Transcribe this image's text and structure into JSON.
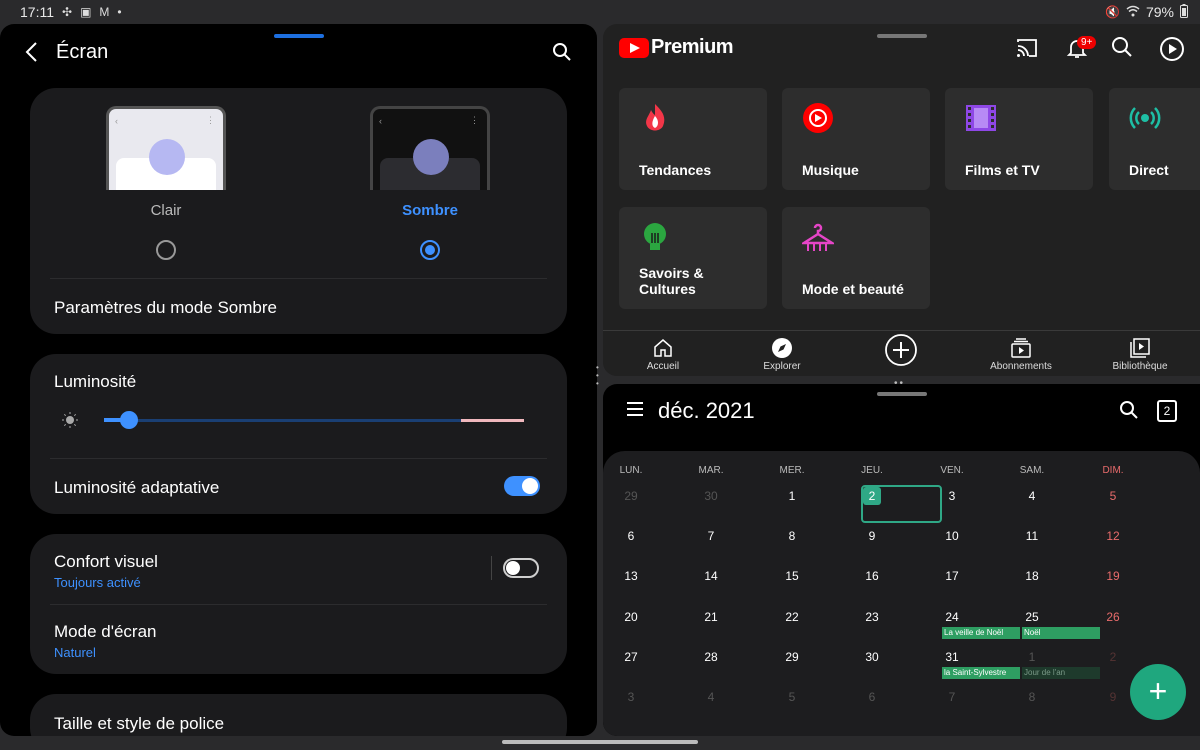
{
  "status": {
    "time": "17:11",
    "battery": "79%"
  },
  "settings": {
    "title": "Écran",
    "themes": {
      "light": "Clair",
      "dark": "Sombre"
    },
    "dark_mode_settings": "Paramètres du mode Sombre",
    "brightness": {
      "label": "Luminosité",
      "level": 0.06
    },
    "adaptive_brightness": {
      "label": "Luminosité adaptative",
      "on": true
    },
    "eye_comfort": {
      "label": "Confort visuel",
      "sub": "Toujours activé",
      "on": false
    },
    "screen_mode": {
      "label": "Mode d'écran",
      "sub": "Naturel"
    },
    "font": "Taille et style de police"
  },
  "youtube": {
    "brand": "Premium",
    "badge": "9+",
    "tiles": [
      {
        "label": "Tendances",
        "icon": "flame-icon"
      },
      {
        "label": "Musique",
        "icon": "music-icon"
      },
      {
        "label": "Films et TV",
        "icon": "film-icon"
      },
      {
        "label": "Direct",
        "icon": "live-icon"
      },
      {
        "label": "Savoirs & Cultures",
        "icon": "lightbulb-icon"
      },
      {
        "label": "Mode et beauté",
        "icon": "hanger-icon"
      }
    ],
    "nav": [
      "Accueil",
      "Explorer",
      "Abonnements",
      "Bibliothèque"
    ]
  },
  "calendar": {
    "month": "déc. 2021",
    "today_icon": "2",
    "days_of_week": [
      "LUN.",
      "MAR.",
      "MER.",
      "JEU.",
      "VEN.",
      "SAM.",
      "DIM."
    ],
    "weeks": [
      [
        "29",
        "30",
        "1",
        "2",
        "3",
        "4",
        "5"
      ],
      [
        "6",
        "7",
        "8",
        "9",
        "10",
        "11",
        "12"
      ],
      [
        "13",
        "14",
        "15",
        "16",
        "17",
        "18",
        "19"
      ],
      [
        "20",
        "21",
        "22",
        "23",
        "24",
        "25",
        "26"
      ],
      [
        "27",
        "28",
        "29",
        "30",
        "31",
        "1",
        "2"
      ],
      [
        "3",
        "4",
        "5",
        "6",
        "7",
        "8",
        "9"
      ]
    ],
    "today": "2",
    "events": [
      "La veille de Noël",
      "Noël",
      "la Saint-Sylvestre",
      "Jour de l'an"
    ]
  }
}
